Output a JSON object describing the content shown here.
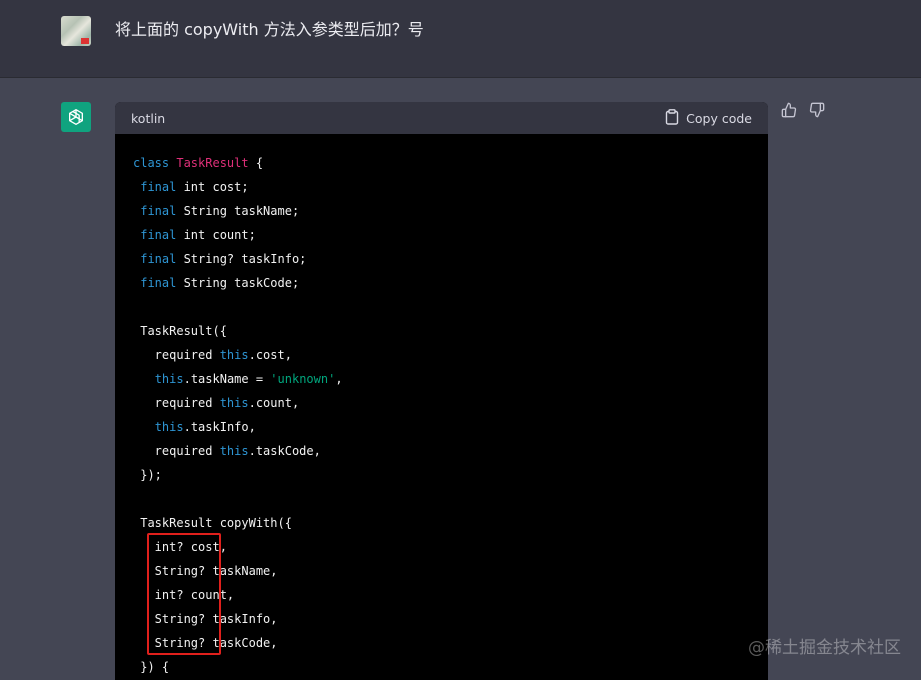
{
  "user_message": {
    "text": "将上面的 copyWith 方法入参类型后加？号"
  },
  "code_block": {
    "language": "kotlin",
    "copy_label": "Copy code"
  },
  "code_lines": [
    [
      {
        "t": "class ",
        "c": "kw"
      },
      {
        "t": "TaskResult",
        "c": "cls"
      },
      {
        "t": " {",
        "c": ""
      }
    ],
    [
      {
        "t": " ",
        "c": ""
      },
      {
        "t": "final",
        "c": "kw"
      },
      {
        "t": " int cost;",
        "c": ""
      }
    ],
    [
      {
        "t": " ",
        "c": ""
      },
      {
        "t": "final",
        "c": "kw"
      },
      {
        "t": " String taskName;",
        "c": ""
      }
    ],
    [
      {
        "t": " ",
        "c": ""
      },
      {
        "t": "final",
        "c": "kw"
      },
      {
        "t": " int count;",
        "c": ""
      }
    ],
    [
      {
        "t": " ",
        "c": ""
      },
      {
        "t": "final",
        "c": "kw"
      },
      {
        "t": " String? taskInfo;",
        "c": ""
      }
    ],
    [
      {
        "t": " ",
        "c": ""
      },
      {
        "t": "final",
        "c": "kw"
      },
      {
        "t": " String taskCode;",
        "c": ""
      }
    ],
    [
      {
        "t": "",
        "c": ""
      }
    ],
    [
      {
        "t": " TaskResult({",
        "c": ""
      }
    ],
    [
      {
        "t": "   required ",
        "c": ""
      },
      {
        "t": "this",
        "c": "kw"
      },
      {
        "t": ".cost,",
        "c": ""
      }
    ],
    [
      {
        "t": "   ",
        "c": ""
      },
      {
        "t": "this",
        "c": "kw"
      },
      {
        "t": ".taskName = ",
        "c": ""
      },
      {
        "t": "'unknown'",
        "c": "str"
      },
      {
        "t": ",",
        "c": ""
      }
    ],
    [
      {
        "t": "   required ",
        "c": ""
      },
      {
        "t": "this",
        "c": "kw"
      },
      {
        "t": ".count,",
        "c": ""
      }
    ],
    [
      {
        "t": "   ",
        "c": ""
      },
      {
        "t": "this",
        "c": "kw"
      },
      {
        "t": ".taskInfo,",
        "c": ""
      }
    ],
    [
      {
        "t": "   required ",
        "c": ""
      },
      {
        "t": "this",
        "c": "kw"
      },
      {
        "t": ".taskCode,",
        "c": ""
      }
    ],
    [
      {
        "t": " });",
        "c": ""
      }
    ],
    [
      {
        "t": "",
        "c": ""
      }
    ],
    [
      {
        "t": " TaskResult copyWith({",
        "c": ""
      }
    ],
    [
      {
        "t": "   int? cost,",
        "c": ""
      }
    ],
    [
      {
        "t": "   String? taskName,",
        "c": ""
      }
    ],
    [
      {
        "t": "   int? count,",
        "c": ""
      }
    ],
    [
      {
        "t": "   String? taskInfo,",
        "c": ""
      }
    ],
    [
      {
        "t": "   String? taskCode,",
        "c": ""
      }
    ],
    [
      {
        "t": " }) {",
        "c": ""
      }
    ]
  ],
  "watermark": "@稀土掘金技术社区",
  "icons": {
    "user_avatar": "user-avatar",
    "gpt_logo": "openai-logo-icon",
    "copy": "clipboard-icon",
    "thumbs_up": "thumbs-up-icon",
    "thumbs_down": "thumbs-down-icon"
  },
  "colors": {
    "keyword": "#2e95d3",
    "class_name": "#df3079",
    "string": "#00a67d",
    "highlight_box": "#e0201c",
    "gpt_avatar": "#10a37f"
  }
}
